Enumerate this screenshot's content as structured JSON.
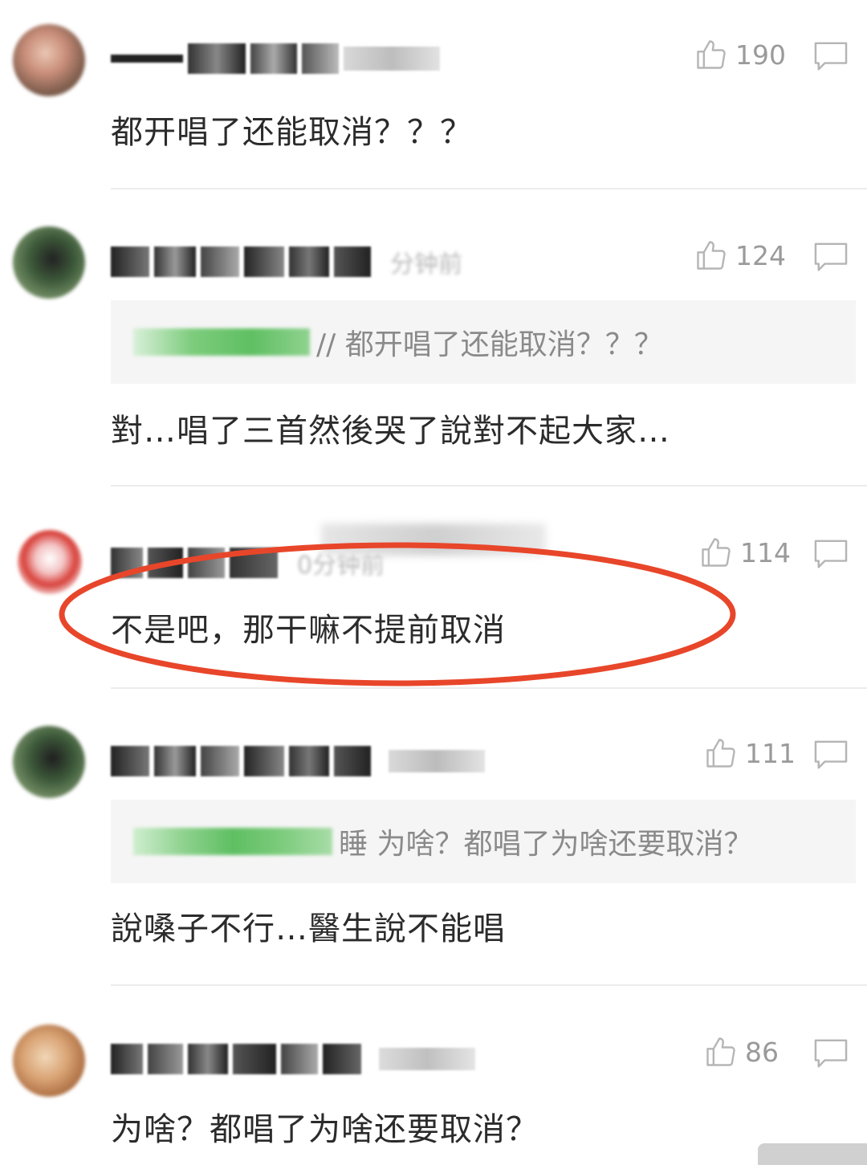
{
  "comments": [
    {
      "likes": "190",
      "text": "都开唱了还能取消？？？"
    },
    {
      "time": "分钟前",
      "likes": "124",
      "quote_text": "// 都开唱了还能取消？？？",
      "text": "對…唱了三首然後哭了說對不起大家…"
    },
    {
      "time": "0分钟前",
      "likes": "114",
      "text": "不是吧，那干嘛不提前取消"
    },
    {
      "likes": "111",
      "quote_text": "睡 为啥？都唱了为啥还要取消？",
      "text": "說嗓子不行…醫生說不能唱"
    },
    {
      "likes": "86",
      "text": "为啥？都唱了为啥还要取消？"
    }
  ],
  "icons": {
    "like": "thumbs-up-icon",
    "reply": "comment-bubble-icon"
  },
  "colors": {
    "highlight_ellipse": "#e8462a",
    "quote_user_green": "#5fbf62",
    "like_gray": "#9a9a9a",
    "text_dark": "#2b2b2b"
  }
}
